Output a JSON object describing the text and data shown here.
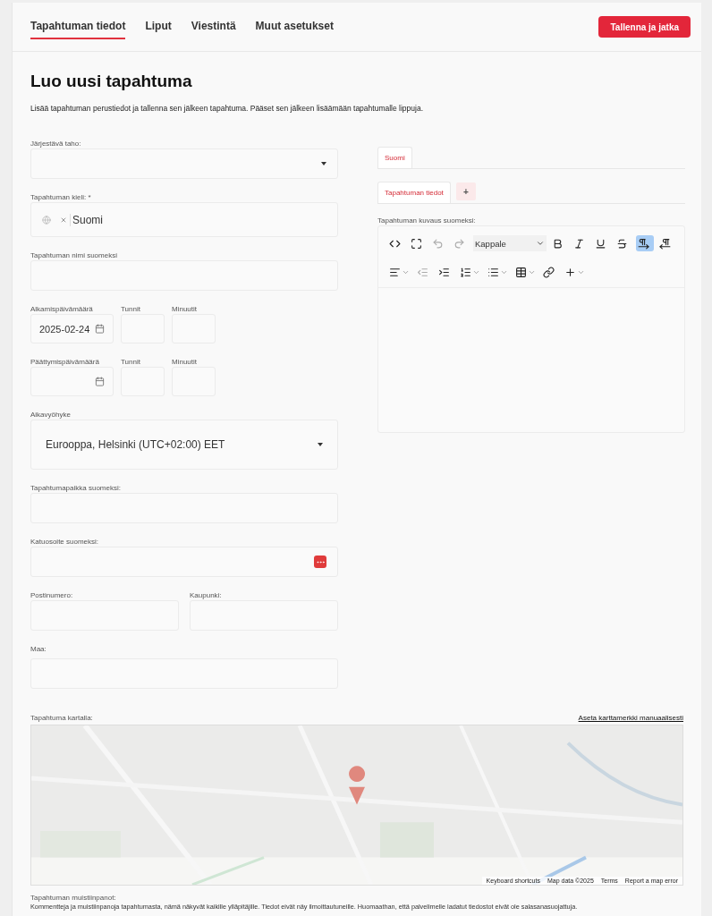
{
  "tabs": [
    {
      "label": "Tapahtuman tiedot",
      "selected": true
    },
    {
      "label": "Liput",
      "selected": false
    },
    {
      "label": "Viestintä",
      "selected": false
    },
    {
      "label": "Muut asetukset",
      "selected": false
    }
  ],
  "save_button": "Tallenna ja jatka",
  "title": "Luo uusi tapahtuma",
  "description": "Lisää tapahtuman perustiedot ja tallenna sen jälkeen tapahtuma. Pääset sen jälkeen lisäämään tapahtumalle lippuja.",
  "organizer": {
    "label": "Järjestävä taho:"
  },
  "language": {
    "label": "Tapahtuman kieli: *",
    "chips": [
      "Suomi"
    ]
  },
  "name": {
    "label": "Tapahtuman nimi suomeksi"
  },
  "start": {
    "date_label": "Alkamispäivämäärä",
    "date": "2025-02-24",
    "hours_label": "Tunnit",
    "minutes_label": "Minuutit"
  },
  "end": {
    "date_label": "Päättymispäivämäärä",
    "hours_label": "Tunnit",
    "minutes_label": "Minuutit"
  },
  "timezone": {
    "label": "Aikavyöhyke",
    "value": "Eurooppa, Helsinki (UTC+02:00) EET"
  },
  "venue": {
    "label": "Tapahtumapaikka suomeksi:"
  },
  "street": {
    "label": "Katuosoite suomeksi:"
  },
  "postal": {
    "label": "Postinumero:"
  },
  "city": {
    "label": "Kaupunki:"
  },
  "country": {
    "label": "Maa:"
  },
  "language_tabs": [
    {
      "label": "Suomi",
      "selected": true
    }
  ],
  "section_tabs": [
    {
      "label": "Tapahtuman tiedot",
      "selected": true
    }
  ],
  "add_tab": "+",
  "editor": {
    "label": "Tapahtuman kuvaus suomeksi:",
    "block_format": "Kappale",
    "row1": [
      {
        "kind": "code",
        "disabled": false,
        "selected": false
      },
      {
        "kind": "fullscreen",
        "disabled": false,
        "selected": false
      },
      {
        "kind": "undo",
        "disabled": true,
        "selected": false
      },
      {
        "kind": "redo",
        "disabled": true,
        "selected": false
      },
      {
        "kind": "format"
      },
      {
        "kind": "bold",
        "disabled": false,
        "selected": false
      },
      {
        "kind": "italic",
        "disabled": false,
        "selected": false
      },
      {
        "kind": "underline",
        "disabled": false,
        "selected": false
      },
      {
        "kind": "strike",
        "disabled": false,
        "selected": false
      },
      {
        "kind": "ltr",
        "disabled": false,
        "selected": true
      },
      {
        "kind": "rtl",
        "disabled": false,
        "selected": false
      }
    ],
    "row2": [
      {
        "kind": "align",
        "disabled": false,
        "selected": false
      },
      {
        "kind": "outdent",
        "disabled": true,
        "selected": false
      },
      {
        "kind": "indent",
        "disabled": false,
        "selected": false
      },
      {
        "kind": "ordered",
        "disabled": false,
        "selected": false
      },
      {
        "kind": "bullets",
        "disabled": false,
        "selected": false
      },
      {
        "kind": "table",
        "disabled": false,
        "selected": false
      },
      {
        "kind": "link",
        "disabled": false,
        "selected": false
      },
      {
        "kind": "insert",
        "disabled": false,
        "selected": false
      }
    ]
  },
  "map": {
    "label": "Tapahtuma kartalla:",
    "manual_link": "Aseta karttamerkki manuaalisesti",
    "attribution": [
      "Keyboard shortcuts",
      "Map data ©2025",
      "Terms",
      "Report a map error"
    ]
  },
  "notes": {
    "label": "Tapahtuman muistiinpanot:",
    "help": "Kommentteja ja muistiinpanoja tapahtumasta, nämä näkyvät kaikille ylläpitäjille. Tiedot eivät näy ilmoittautuneille. Huomaathan, että palvelimelle ladatut tiedostot eivät ole salasanasuojattuja."
  }
}
